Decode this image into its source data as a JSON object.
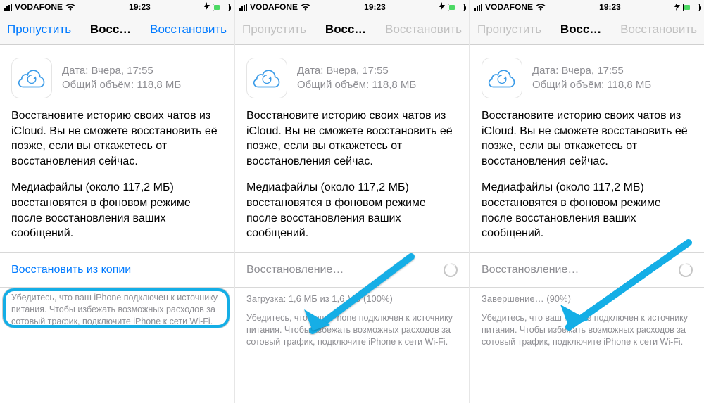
{
  "status": {
    "carrier": "VODAFONE",
    "time": "19:23"
  },
  "nav": {
    "skip": "Пропустить",
    "title_truncated": "Восс…",
    "restore": "Восстановить"
  },
  "backup": {
    "date_label": "Дата: Вчера, 17:55",
    "size_label": "Общий объём: 118,8 МБ"
  },
  "body": {
    "p1": "Восстановите историю своих чатов из iCloud. Вы не сможете восстановить её позже, если вы откажетесь от восстановления сейчас.",
    "p2": "Медиафайлы (около 117,2 МБ) восстановятся в фоновом режиме после восстановления ваших сообщений."
  },
  "restore_button": {
    "label": "Восстановить из копии",
    "loading_label": "Восстановление…"
  },
  "progress": {
    "screen2": "Загрузка: 1,6 МБ из 1,6 МБ (100%)",
    "screen3": "Завершение… (90%)"
  },
  "footer": {
    "text": "Убедитесь, что ваш iPhone подключен к источнику питания. Чтобы избежать возможных расходов за сотовый трафик, подключите iPhone к сети Wi-Fi."
  }
}
